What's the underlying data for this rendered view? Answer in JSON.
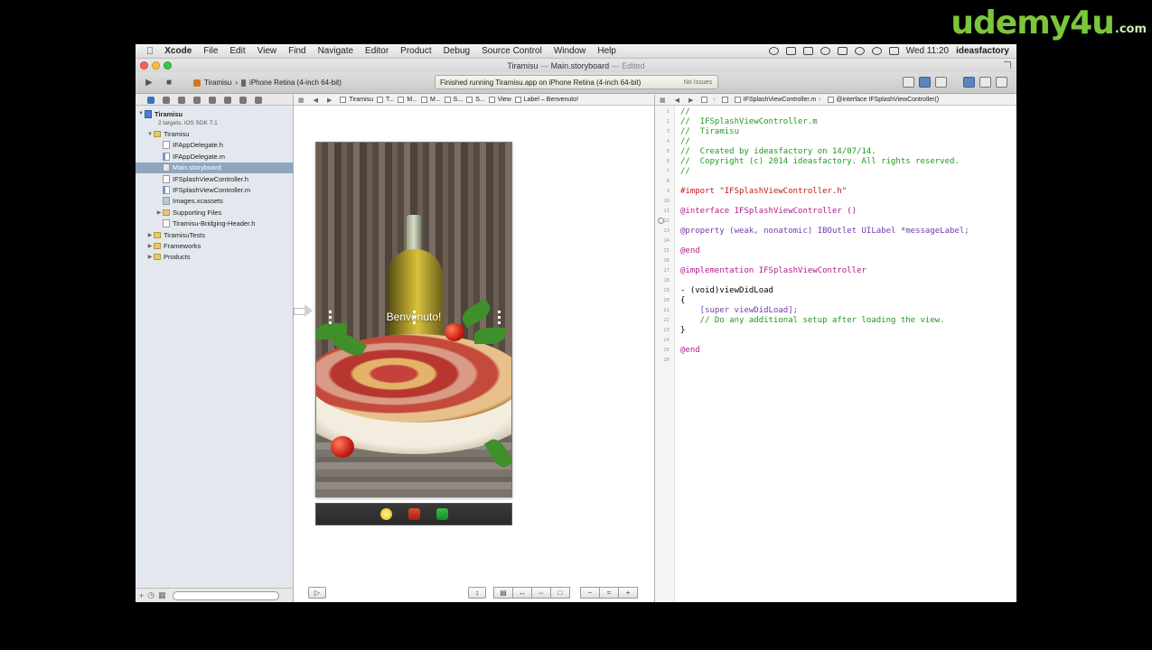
{
  "watermark": {
    "main": "udemy4u",
    "suffix": ".com"
  },
  "menubar": {
    "app_name": "Xcode",
    "items": [
      "File",
      "Edit",
      "View",
      "Find",
      "Navigate",
      "Editor",
      "Product",
      "Debug",
      "Source Control",
      "Window",
      "Help"
    ],
    "clock": "Wed 11:20",
    "user": "ideasfactory"
  },
  "window": {
    "title_project": "Tiramisu",
    "title_sep": "—",
    "title_file": "Main.storyboard",
    "title_state": "— Edited"
  },
  "toolbar": {
    "scheme": "Tiramisu",
    "destination": "iPhone Retina (4-inch 64-bit)",
    "activity_message": "Finished running Tiramisu.app on iPhone Retina (4-inch 64-bit)",
    "issues": "No Issues"
  },
  "navigator": {
    "project": {
      "name": "Tiramisu",
      "subtitle": "2 targets, iOS SDK 7.1"
    },
    "group_main": "Tiramisu",
    "files": [
      {
        "name": "IFAppDelegate.h",
        "kind": "h"
      },
      {
        "name": "IFAppDelegate.m",
        "kind": "m"
      },
      {
        "name": "Main.storyboard",
        "kind": "sb"
      },
      {
        "name": "IFSplashViewController.h",
        "kind": "h"
      },
      {
        "name": "IFSplashViewController.m",
        "kind": "m"
      },
      {
        "name": "Images.xcassets",
        "kind": "xc"
      }
    ],
    "supporting_files": "Supporting Files",
    "bridging_header": "Tiramisu-Bridging-Header.h",
    "groups_bottom": [
      "TiramisuTests",
      "Frameworks",
      "Products"
    ]
  },
  "canvas": {
    "jump_items": [
      "Tiramisu",
      "T...",
      "M...",
      "M...",
      "S...",
      "S...",
      "View",
      "Label – Benvenuto!"
    ],
    "label_text": "Benvenuto!"
  },
  "editor": {
    "jump_file": "IFSplashViewController.m",
    "jump_symbol": "@interface IFSplashViewController()",
    "lines": [
      "//",
      "//  IFSplashViewController.m",
      "//  Tiramisu",
      "//",
      "//  Created by ideasfactory on 14/07/14.",
      "//  Copyright (c) 2014 ideasfactory. All rights reserved.",
      "//",
      "",
      "#import \"IFSplashViewController.h\"",
      "",
      "@interface IFSplashViewController ()",
      "",
      "@property (weak, nonatomic) IBOutlet UILabel *messageLabel;",
      "",
      "@end",
      "",
      "@implementation IFSplashViewController",
      "",
      "- (void)viewDidLoad",
      "{",
      "    [super viewDidLoad];",
      "    // Do any additional setup after loading the view.",
      "}",
      "",
      "@end",
      ""
    ]
  }
}
